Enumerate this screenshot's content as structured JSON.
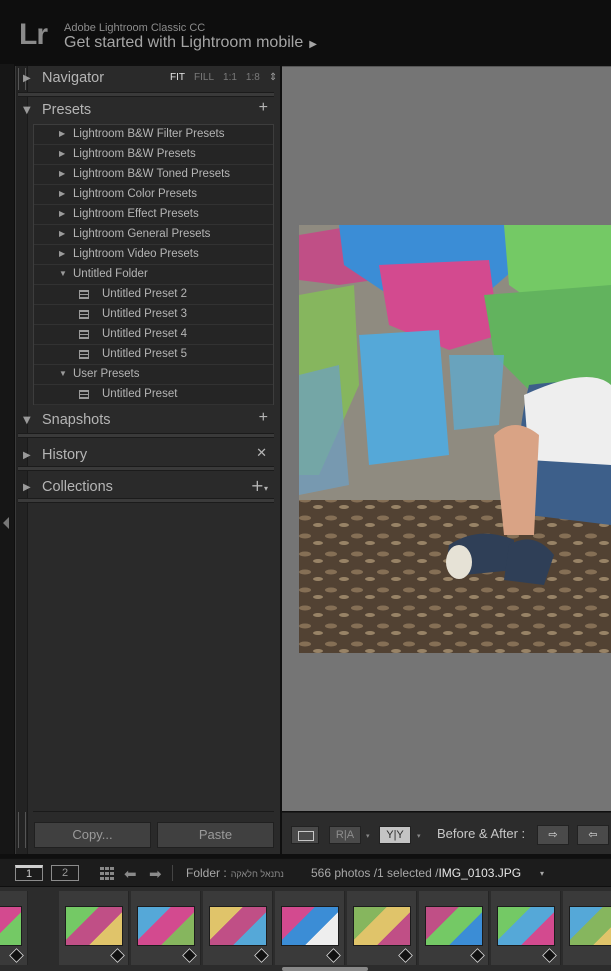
{
  "identity": {
    "logo": "Lr",
    "app_name": "Adobe Lightroom Classic CC",
    "get_started": "Get started with Lightroom mobile",
    "get_started_arrow": "▶"
  },
  "navigator": {
    "title": "Navigator",
    "arrow": "▶",
    "zoom": [
      "FIT",
      "FILL",
      "1:1",
      "1:8"
    ],
    "spin": "⇕"
  },
  "presets": {
    "title": "Presets",
    "arrow": "▼",
    "add": "+",
    "rows": [
      {
        "type": "folder",
        "arrow": "▶",
        "label": "Lightroom B&W Filter Presets"
      },
      {
        "type": "folder",
        "arrow": "▶",
        "label": "Lightroom B&W Presets"
      },
      {
        "type": "folder",
        "arrow": "▶",
        "label": "Lightroom B&W Toned Presets"
      },
      {
        "type": "folder",
        "arrow": "▶",
        "label": "Lightroom Color Presets"
      },
      {
        "type": "folder",
        "arrow": "▶",
        "label": "Lightroom Effect Presets"
      },
      {
        "type": "folder",
        "arrow": "▶",
        "label": "Lightroom General Presets"
      },
      {
        "type": "folder",
        "arrow": "▶",
        "label": "Lightroom Video Presets"
      },
      {
        "type": "folder",
        "arrow": "▼",
        "label": "Untitled Folder"
      },
      {
        "type": "item",
        "label": "Untitled Preset 2"
      },
      {
        "type": "item",
        "label": "Untitled Preset 3"
      },
      {
        "type": "item",
        "label": "Untitled Preset 4"
      },
      {
        "type": "item",
        "label": "Untitled Preset 5"
      },
      {
        "type": "folder",
        "arrow": "▼",
        "label": "User Presets"
      },
      {
        "type": "item",
        "label": "Untitled Preset"
      }
    ]
  },
  "snapshots": {
    "title": "Snapshots",
    "arrow": "▼",
    "add": "+"
  },
  "history": {
    "title": "History",
    "arrow": "▶",
    "clear": "✕"
  },
  "collections": {
    "title": "Collections",
    "arrow": "▶",
    "add": "+"
  },
  "actions": {
    "copy": "Copy...",
    "paste": "Paste"
  },
  "toolbar": {
    "ra": "R|A",
    "yy": "Y|Y",
    "dropdown": "▾",
    "before_after": "Before & After :",
    "swap": "⇨",
    "copy_back": "⇦"
  },
  "filmbar": {
    "monitor1": "1",
    "monitor2": "2",
    "back": "⬅",
    "forward": "➡",
    "folder_label": "Folder :",
    "folder_name": "נתנאל חלאקה",
    "count": "566 photos /1 selected /",
    "filename": "IMG_0103.JPG",
    "dropdown": "▾"
  },
  "filmstrip": {
    "thumbnail_count": 9
  },
  "colors": {
    "panel_bg": "#2a2a2a",
    "center_bg": "#757575",
    "accent_text": "#e5e5e5"
  }
}
